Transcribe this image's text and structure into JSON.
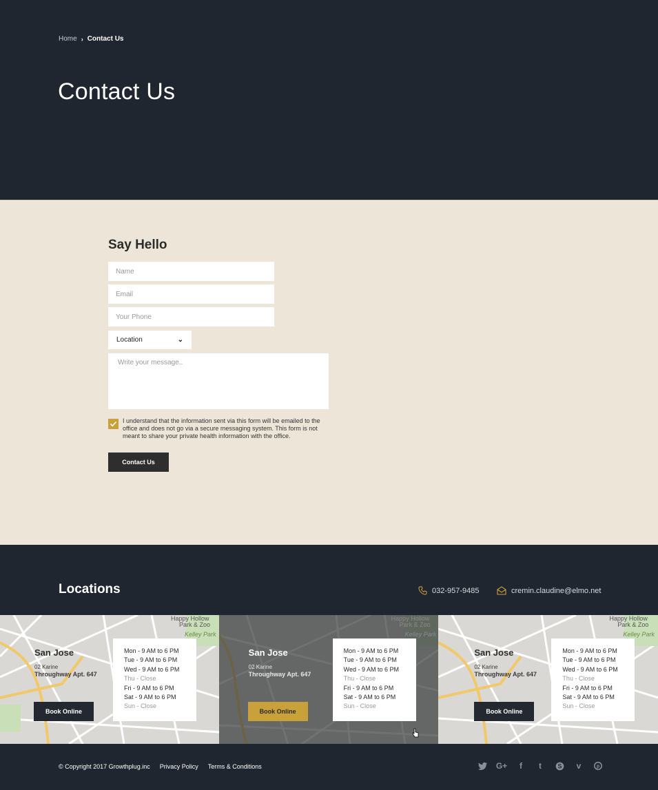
{
  "breadcrumb": {
    "home": "Home",
    "current": "Contact Us"
  },
  "hero": {
    "title": "Contact Us"
  },
  "form": {
    "heading": "Say Hello",
    "name_placeholder": "Name",
    "email_placeholder": "Email",
    "phone_placeholder": "Your Phone",
    "location_value": "Location",
    "message_placeholder": "Write your message..",
    "consent": "I understand that the information sent via this form will be emailed to the office and does not go via a secure messaging system. This form is not meant to share your private health information with the office.",
    "consent_checked": true,
    "submit_label": "Contact Us"
  },
  "locations": {
    "title": "Locations",
    "phone": "032-957-9485",
    "email": "cremin.claudine@elmo.net",
    "items": [
      {
        "city": "San Jose",
        "address_line1": "02 Karine",
        "address_line2": "Throughway Apt. 647",
        "book_label": "Book Online",
        "hours": [
          "Mon - 9 AM to 6 PM",
          "Tue - 9 AM to 6 PM",
          "Wed - 9 AM to 6 PM",
          "Thu - Close",
          "Fri - 9 AM to 6 PM",
          "Sat - 9 AM to 6 PM",
          "Sun - Close"
        ],
        "map_labels": [
          "Happy Hollow",
          "Park & Zoo",
          "Kelley Park"
        ]
      },
      {
        "city": "San Jose",
        "address_line1": "02 Karine",
        "address_line2": "Throughway Apt. 647",
        "book_label": "Book Online",
        "hours": [
          "Mon - 9 AM to 6 PM",
          "Tue - 9 AM to 6 PM",
          "Wed - 9 AM to 6 PM",
          "Thu - Close",
          "Fri - 9 AM to 6 PM",
          "Sat - 9 AM to 6 PM",
          "Sun - Close"
        ],
        "map_labels": [
          "Happy Hollow",
          "Park & Zoo",
          "Kelley Park"
        ]
      },
      {
        "city": "San Jose",
        "address_line1": "02 Karine",
        "address_line2": "Throughway Apt. 647",
        "book_label": "Book Online",
        "hours": [
          "Mon - 9 AM to 6 PM",
          "Tue - 9 AM to 6 PM",
          "Wed - 9 AM to 6 PM",
          "Thu - Close",
          "Fri - 9 AM to 6 PM",
          "Sat - 9 AM to 6 PM",
          "Sun - Close"
        ],
        "map_labels": [
          "Happy Hollow",
          "Park & Zoo",
          "Kelley Park"
        ]
      }
    ]
  },
  "footer": {
    "copyright": "© Copyright 2017 Growthplug.inc",
    "privacy": "Privacy Policy",
    "terms": "Terms & Conditions",
    "social_icons": [
      "twitter-icon",
      "google-plus-icon",
      "facebook-icon",
      "tumblr-icon",
      "skype-icon",
      "vimeo-icon",
      "pinterest-icon"
    ]
  },
  "colors": {
    "dark": "#20262f",
    "cream": "#ede6d8",
    "gold": "#c9a13b"
  }
}
